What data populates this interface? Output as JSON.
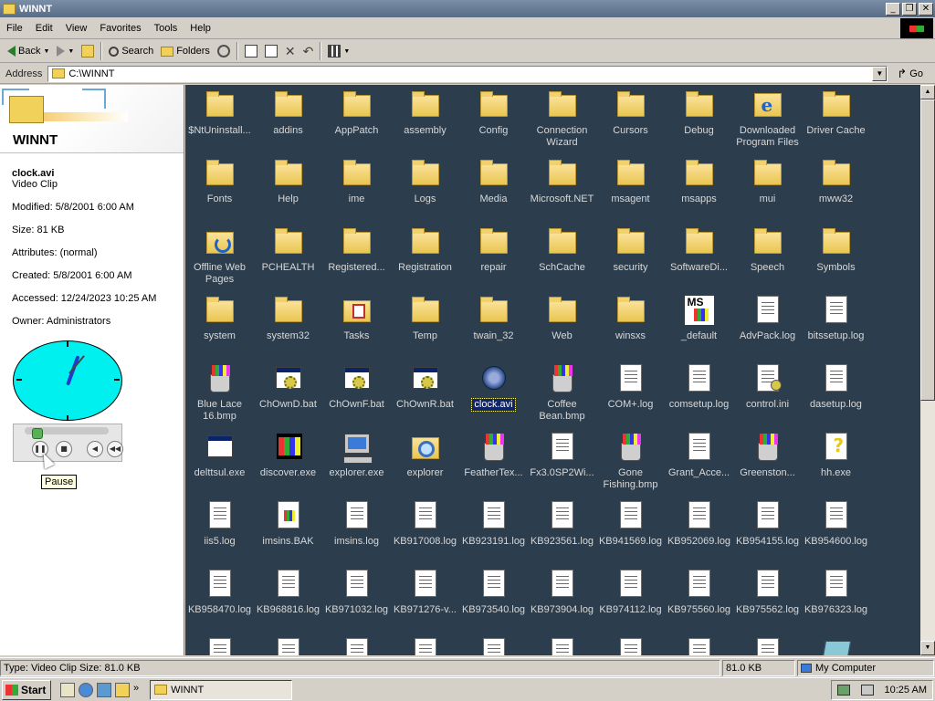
{
  "window": {
    "title": "WINNT",
    "minimize": "0",
    "restore": "1",
    "close": "r"
  },
  "menu": {
    "items": [
      "File",
      "Edit",
      "View",
      "Favorites",
      "Tools",
      "Help"
    ]
  },
  "toolbar": {
    "back": "Back",
    "search": "Search",
    "folders": "Folders"
  },
  "address": {
    "label": "Address",
    "value": "C:\\WINNT",
    "go": "Go"
  },
  "info": {
    "folder_title": "WINNT",
    "file_name": "clock.avi",
    "file_type": "Video Clip",
    "properties": [
      "Modified: 5/8/2001 6:00 AM",
      "Size: 81 KB",
      "Attributes: (normal)",
      "Created: 5/8/2001 6:00 AM",
      "Accessed: 12/24/2023 10:25 AM",
      "Owner: Administrators"
    ],
    "tooltip": "Pause",
    "player_progress_fraction": 0.1
  },
  "files": [
    {
      "label": "$NtUninstall...",
      "icon": "folder"
    },
    {
      "label": "addins",
      "icon": "folder"
    },
    {
      "label": "AppPatch",
      "icon": "folder"
    },
    {
      "label": "assembly",
      "icon": "folder"
    },
    {
      "label": "Config",
      "icon": "folder"
    },
    {
      "label": "Connection Wizard",
      "icon": "folder"
    },
    {
      "label": "Cursors",
      "icon": "folder"
    },
    {
      "label": "Debug",
      "icon": "folder"
    },
    {
      "label": "Downloaded Program Files",
      "icon": "ie"
    },
    {
      "label": "Driver Cache",
      "icon": "folder"
    },
    {
      "label": "Fonts",
      "icon": "folder"
    },
    {
      "label": "Help",
      "icon": "folder"
    },
    {
      "label": "ime",
      "icon": "folder"
    },
    {
      "label": "Logs",
      "icon": "folder"
    },
    {
      "label": "Media",
      "icon": "folder"
    },
    {
      "label": "Microsoft.NET",
      "icon": "folder"
    },
    {
      "label": "msagent",
      "icon": "folder"
    },
    {
      "label": "msapps",
      "icon": "folder"
    },
    {
      "label": "mui",
      "icon": "folder"
    },
    {
      "label": "mww32",
      "icon": "folder"
    },
    {
      "label": "Offline Web Pages",
      "icon": "offline"
    },
    {
      "label": "PCHEALTH",
      "icon": "folder"
    },
    {
      "label": "Registered...",
      "icon": "folder"
    },
    {
      "label": "Registration",
      "icon": "folder"
    },
    {
      "label": "repair",
      "icon": "folder"
    },
    {
      "label": "SchCache",
      "icon": "folder"
    },
    {
      "label": "security",
      "icon": "folder"
    },
    {
      "label": "SoftwareDi...",
      "icon": "folder"
    },
    {
      "label": "Speech",
      "icon": "folder"
    },
    {
      "label": "Symbols",
      "icon": "folder"
    },
    {
      "label": "system",
      "icon": "folder"
    },
    {
      "label": "system32",
      "icon": "folder"
    },
    {
      "label": "Tasks",
      "icon": "tasks"
    },
    {
      "label": "Temp",
      "icon": "folder"
    },
    {
      "label": "twain_32",
      "icon": "folder"
    },
    {
      "label": "Web",
      "icon": "folder"
    },
    {
      "label": "winsxs",
      "icon": "folder"
    },
    {
      "label": "_default",
      "icon": "ms"
    },
    {
      "label": "AdvPack.log",
      "icon": "doc"
    },
    {
      "label": "bitssetup.log",
      "icon": "doc"
    },
    {
      "label": "Blue Lace 16.bmp",
      "icon": "paint"
    },
    {
      "label": "ChOwnD.bat",
      "icon": "bat"
    },
    {
      "label": "ChOwnF.bat",
      "icon": "bat"
    },
    {
      "label": "ChOwnR.bat",
      "icon": "bat"
    },
    {
      "label": "clock.avi",
      "icon": "media",
      "selected": true
    },
    {
      "label": "Coffee Bean.bmp",
      "icon": "paint"
    },
    {
      "label": "COM+.log",
      "icon": "doc"
    },
    {
      "label": "comsetup.log",
      "icon": "doc"
    },
    {
      "label": "control.ini",
      "icon": "ini"
    },
    {
      "label": "dasetup.log",
      "icon": "doc"
    },
    {
      "label": "delttsul.exe",
      "icon": "window"
    },
    {
      "label": "discover.exe",
      "icon": "tri"
    },
    {
      "label": "explorer.exe",
      "icon": "computer"
    },
    {
      "label": "explorer",
      "icon": "search"
    },
    {
      "label": "FeatherTex...",
      "icon": "paint"
    },
    {
      "label": "Fx3.0SP2Wi...",
      "icon": "doc"
    },
    {
      "label": "Gone Fishing.bmp",
      "icon": "paint"
    },
    {
      "label": "Grant_Acce...",
      "icon": "doc"
    },
    {
      "label": "Greenston...",
      "icon": "paint"
    },
    {
      "label": "hh.exe",
      "icon": "help"
    },
    {
      "label": "iis5.log",
      "icon": "doc"
    },
    {
      "label": "imsins.BAK",
      "icon": "bak"
    },
    {
      "label": "imsins.log",
      "icon": "doc"
    },
    {
      "label": "KB917008.log",
      "icon": "doc"
    },
    {
      "label": "KB923191.log",
      "icon": "doc"
    },
    {
      "label": "KB923561.log",
      "icon": "doc"
    },
    {
      "label": "KB941569.log",
      "icon": "doc"
    },
    {
      "label": "KB952069.log",
      "icon": "doc"
    },
    {
      "label": "KB954155.log",
      "icon": "doc"
    },
    {
      "label": "KB954600.log",
      "icon": "doc"
    },
    {
      "label": "KB958470.log",
      "icon": "doc"
    },
    {
      "label": "KB968816.log",
      "icon": "doc"
    },
    {
      "label": "KB971032.log",
      "icon": "doc"
    },
    {
      "label": "KB971276-v...",
      "icon": "doc"
    },
    {
      "label": "KB973540.log",
      "icon": "doc"
    },
    {
      "label": "KB973904.log",
      "icon": "doc"
    },
    {
      "label": "KB974112.log",
      "icon": "doc"
    },
    {
      "label": "KB975560.log",
      "icon": "doc"
    },
    {
      "label": "KB975562.log",
      "icon": "doc"
    },
    {
      "label": "KB976323.log",
      "icon": "doc"
    },
    {
      "label": "",
      "icon": "doc"
    },
    {
      "label": "",
      "icon": "doc"
    },
    {
      "label": "",
      "icon": "doc"
    },
    {
      "label": "",
      "icon": "doc"
    },
    {
      "label": "",
      "icon": "doc"
    },
    {
      "label": "",
      "icon": "doc"
    },
    {
      "label": "",
      "icon": "doc"
    },
    {
      "label": "",
      "icon": "doc"
    },
    {
      "label": "",
      "icon": "doc"
    },
    {
      "label": "",
      "icon": "note"
    }
  ],
  "status": {
    "left": "Type: Video Clip Size: 81.0 KB",
    "size": "81.0 KB",
    "zone": "My Computer"
  },
  "taskbar": {
    "start": "Start",
    "task": "WINNT",
    "clock": "10:25 AM"
  }
}
